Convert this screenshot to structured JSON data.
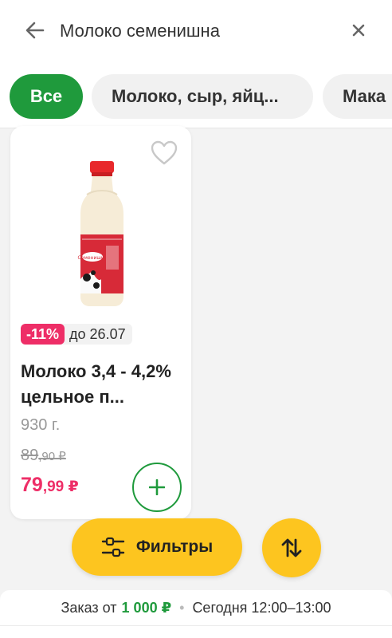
{
  "search": {
    "query": "Молоко семенишна"
  },
  "chips": {
    "all": "Все",
    "dairy": "Молоко, сыр, яйц...",
    "pasta": "Мака"
  },
  "product": {
    "image_label": "Семенишна",
    "discount": "-11%",
    "discount_until": "до 26.07",
    "title": "Молоко 3,4 - 4,2% цельное п...",
    "weight": "930 г.",
    "old_price_rub": "89",
    "old_price_kop": ",90 ₽",
    "price_rub": "79",
    "price_kop": ",99 ₽"
  },
  "actions": {
    "filters": "Фильтры"
  },
  "delivery": {
    "prefix": "Заказ от",
    "min_order": "1 000 ₽",
    "separator": "•",
    "slot": "Сегодня 12:00–13:00"
  },
  "colors": {
    "accent_green": "#1f9a3c",
    "sale_pink": "#ee2e67",
    "yellow": "#fdc51f"
  }
}
